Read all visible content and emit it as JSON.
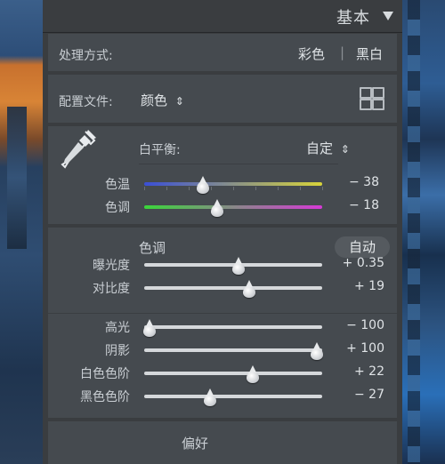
{
  "header": {
    "title": "基本"
  },
  "treatment": {
    "label": "处理方式:",
    "color": "彩色",
    "separator": "|",
    "bw": "黑白"
  },
  "profile": {
    "label": "配置文件:",
    "value": "颜色",
    "arrows": "⇕"
  },
  "white_balance": {
    "label": "白平衡:",
    "value": "自定",
    "sliders": [
      {
        "label": "色温",
        "value": "− 38",
        "position": 0.33
      },
      {
        "label": "色调",
        "value": "− 18",
        "position": 0.41
      }
    ]
  },
  "tone": {
    "title": "色调",
    "auto": "自动",
    "sliders": [
      {
        "label": "曝光度",
        "value": "+ 0.35",
        "position": 0.53
      },
      {
        "label": "对比度",
        "value": "+ 19",
        "position": 0.59
      },
      {
        "label": "高光",
        "value": "− 100",
        "position": 0.03
      },
      {
        "label": "阴影",
        "value": "+ 100",
        "position": 0.97
      },
      {
        "label": "白色色阶",
        "value": "+ 22",
        "position": 0.61
      },
      {
        "label": "黑色色阶",
        "value": "− 27",
        "position": 0.37
      }
    ]
  },
  "presence": {
    "title": "偏好"
  },
  "colors": {
    "temp_gradient": [
      "#3a4fd6",
      "#d8d43a"
    ],
    "tint_gradient": [
      "#3ad63a",
      "#d63ad6"
    ]
  }
}
